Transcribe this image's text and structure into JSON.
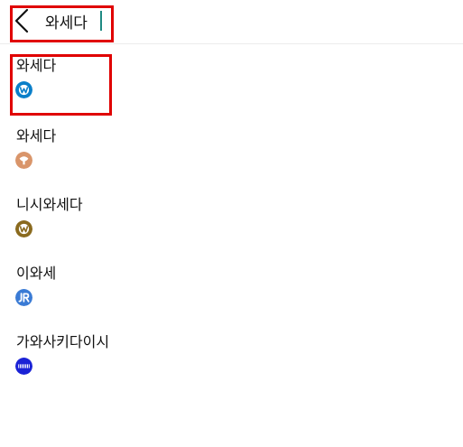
{
  "search": {
    "query": "와세다"
  },
  "results": [
    {
      "name": "와세다",
      "badge_icon": "tokyo-metro-icon",
      "badge_color": "#0a7fc9"
    },
    {
      "name": "와세다",
      "badge_icon": "toden-tram-icon",
      "badge_color": "#d9956a"
    },
    {
      "name": "니시와세다",
      "badge_icon": "tokyo-metro-icon",
      "badge_color": "#8a6a1e"
    },
    {
      "name": "이와세",
      "badge_icon": "jr-icon",
      "badge_color": "#3a7bd5"
    },
    {
      "name": "가와사키다이시",
      "badge_icon": "keikyu-icon",
      "badge_color": "#1a22d6"
    }
  ],
  "colors": {
    "highlight": "#e00000",
    "caret": "#1f8a83"
  }
}
